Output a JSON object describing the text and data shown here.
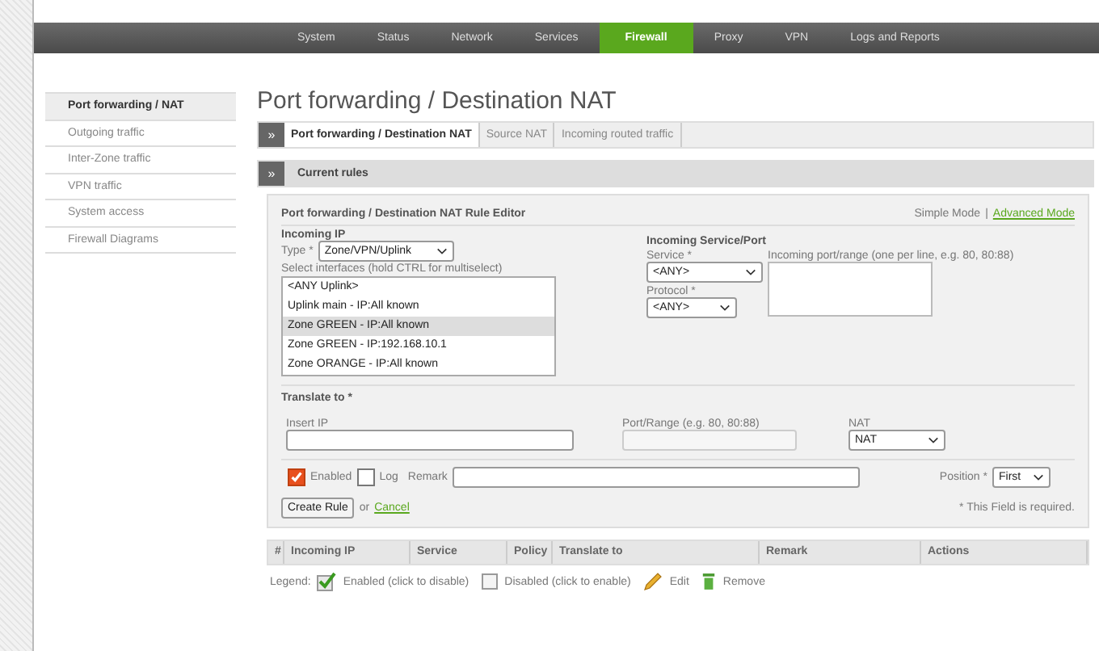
{
  "menu": [
    {
      "label": "System",
      "selected": false
    },
    {
      "label": "Status",
      "selected": false
    },
    {
      "label": "Network",
      "selected": false
    },
    {
      "label": "Services",
      "selected": false
    },
    {
      "label": "Firewall",
      "selected": true
    },
    {
      "label": "Proxy",
      "selected": false
    },
    {
      "label": "VPN",
      "selected": false
    },
    {
      "label": "Logs and Reports",
      "selected": false
    }
  ],
  "sidebar": {
    "items": [
      {
        "label": "Port forwarding / NAT",
        "selected": true
      },
      {
        "label": "Outgoing traffic",
        "selected": false
      },
      {
        "label": "Inter-Zone traffic",
        "selected": false
      },
      {
        "label": "VPN traffic",
        "selected": false
      },
      {
        "label": "System access",
        "selected": false
      },
      {
        "label": "Firewall Diagrams",
        "selected": false
      }
    ]
  },
  "page_title": "Port forwarding / Destination NAT",
  "toggle_glyph": "»",
  "tabs": [
    {
      "label": "Port forwarding / Destination NAT",
      "selected": true
    },
    {
      "label": "Source NAT",
      "selected": false
    },
    {
      "label": "Incoming routed traffic",
      "selected": false
    }
  ],
  "section_title": "Current rules",
  "editor": {
    "title": "Port forwarding / Destination NAT Rule Editor",
    "modes": [
      {
        "label": "Simple Mode",
        "selected": true
      },
      {
        "label": "Advanced Mode",
        "selected": false
      }
    ],
    "mode_separator": "|",
    "incoming_ip": {
      "heading": "Incoming IP",
      "type_label": "Type *",
      "type_value": "Zone/VPN/Uplink",
      "hint": "Select interfaces (hold CTRL for multiselect)",
      "interfaces": [
        {
          "label": "<ANY Uplink>",
          "selected": false
        },
        {
          "label": "Uplink main - IP:All known",
          "selected": false
        },
        {
          "label": "Zone GREEN - IP:All known",
          "selected": true
        },
        {
          "label": "Zone GREEN - IP:192.168.10.1",
          "selected": false
        },
        {
          "label": "Zone ORANGE - IP:All known",
          "selected": false
        }
      ]
    },
    "incoming_service": {
      "heading": "Incoming Service/Port",
      "service_label": "Service *",
      "service_value": "<ANY>",
      "protocol_label": "Protocol *",
      "protocol_value": "<ANY>",
      "port_label": "Incoming port/range (one per line, e.g. 80, 80:88)"
    },
    "translate": {
      "heading": "Translate to *",
      "ip_label": "Insert IP",
      "port_label": "Port/Range (e.g. 80, 80:88)",
      "nat_label": "NAT",
      "nat_value": "NAT"
    },
    "enabled": {
      "label": "Enabled",
      "checked": true
    },
    "log": {
      "label": "Log",
      "checked": false
    },
    "remark_label": "Remark",
    "position_label": "Position *",
    "position_value": "First",
    "create_button": "Create Rule",
    "or_text": "or",
    "cancel_link": "Cancel",
    "required_note": "* This Field is required."
  },
  "table": {
    "columns": [
      "#",
      "Incoming IP",
      "Service",
      "Policy",
      "Translate to",
      "Remark",
      "Actions"
    ]
  },
  "legend": {
    "label": "Legend:",
    "items": [
      {
        "kind": "enabled",
        "label": "Enabled (click to disable)"
      },
      {
        "kind": "disabled",
        "label": "Disabled (click to enable)"
      },
      {
        "kind": "edit",
        "label": "Edit"
      },
      {
        "kind": "remove",
        "label": "Remove"
      }
    ]
  }
}
